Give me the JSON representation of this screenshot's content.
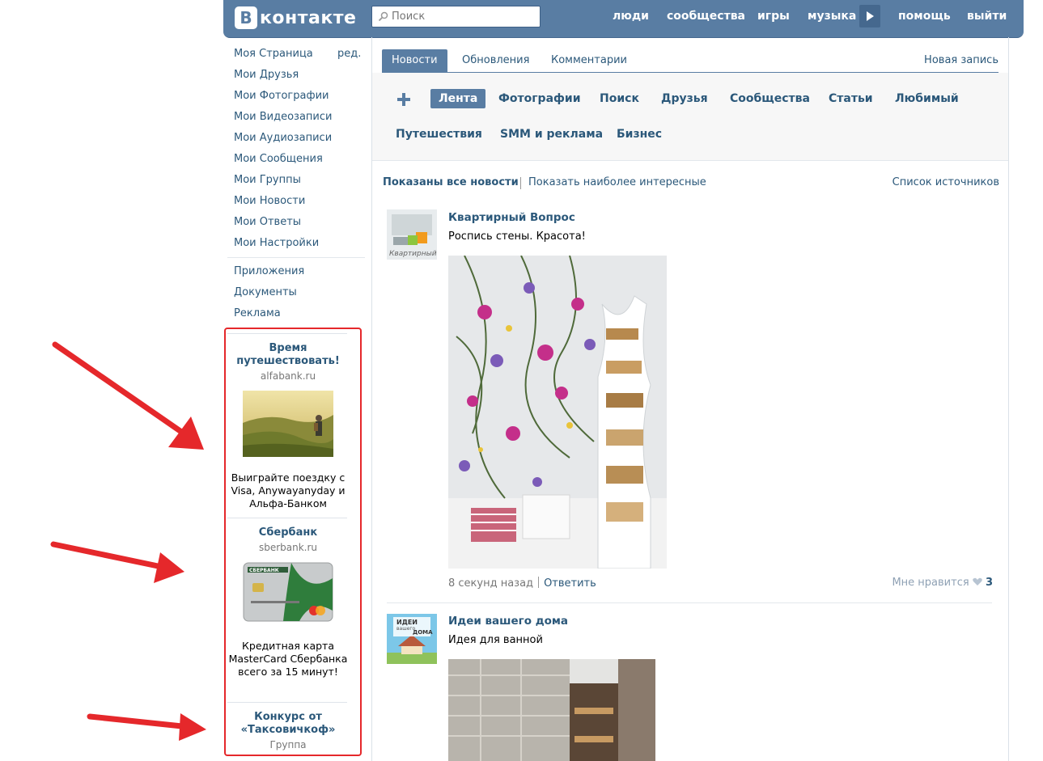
{
  "header": {
    "logo_mark": "В",
    "logo_text": "контакте",
    "search_placeholder": "Поиск",
    "nav": [
      "люди",
      "сообщества",
      "игры",
      "музыка",
      "помощь",
      "выйти"
    ]
  },
  "left_menu": {
    "edit": "ред.",
    "group1": [
      "Моя Страница",
      "Мои Друзья",
      "Мои Фотографии",
      "Мои Видеозаписи",
      "Мои Аудиозаписи",
      "Мои Сообщения",
      "Мои Группы",
      "Мои Новости",
      "Мои Ответы",
      "Мои Настройки"
    ],
    "group2": [
      "Приложения",
      "Документы",
      "Реклама"
    ]
  },
  "ads": [
    {
      "title": "Время путешествовать!",
      "domain": "alfabank.ru",
      "desc": "Выиграйте поездку с Visa, Anywayanyday и Альфа-Банком"
    },
    {
      "title": "Сбербанк",
      "domain": "sberbank.ru",
      "desc": "Кредитная карта MasterCard Сбербанка всего за 15 минут!",
      "card_text": "СБЕРБАНК"
    },
    {
      "title": "Конкурс от «Таксовичкоф»",
      "domain": "Группа"
    }
  ],
  "tabs": {
    "items": [
      "Новости",
      "Обновления",
      "Комментарии"
    ],
    "active": 0,
    "new_post": "Новая запись"
  },
  "lists": {
    "row1": [
      "Лента",
      "Фотографии",
      "Поиск",
      "Друзья",
      "Сообщества",
      "Статьи",
      "Любимый"
    ],
    "row2": [
      "Путешествия",
      "SMM и реклама",
      "Бизнес"
    ],
    "active": "Лента"
  },
  "filter": {
    "all": "Показаны все новости",
    "interesting": "Показать наиболее интересные",
    "sources": "Список источников"
  },
  "posts": [
    {
      "author": "Квартирный Вопрос",
      "text": "Роспись стены. Красота!",
      "avatar_caption": "Квартирный",
      "time": "8 секунд назад",
      "reply": "Ответить",
      "like_label": "Мне нравится",
      "likes": "3"
    },
    {
      "author": "Идеи вашего дома",
      "text": "Идея для ванной",
      "avatar_caption_line1": "ИДЕИ",
      "avatar_caption_line2": "вашего",
      "avatar_caption_line3": "ДОМА"
    }
  ],
  "colors": {
    "header": "#597da3",
    "link": "#2b587a",
    "ad_border": "#e5282b",
    "arrow": "#e5282b"
  }
}
